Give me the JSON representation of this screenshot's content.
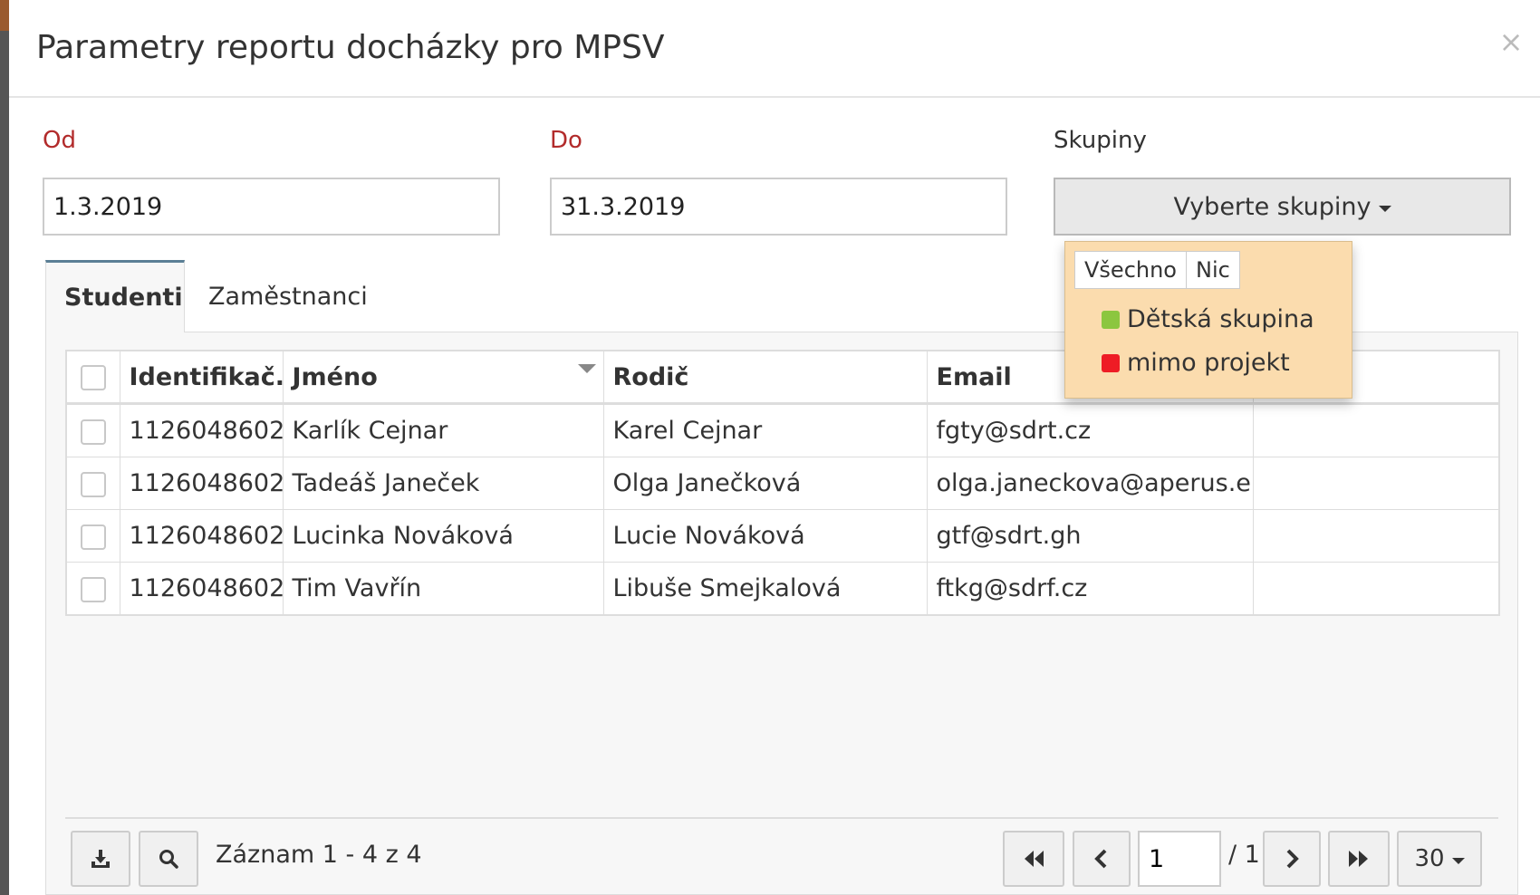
{
  "modal": {
    "title": "Parametry reportu docházky pro MPSV",
    "close_symbol": "×"
  },
  "form": {
    "from": {
      "label": "Od",
      "value": "1.3.2019"
    },
    "to": {
      "label": "Do",
      "value": "31.3.2019"
    },
    "groups": {
      "label": "Skupiny",
      "button_label": "Vyberte skupiny"
    }
  },
  "groups_dropdown": {
    "select_all": "Všechno",
    "select_none": "Nic",
    "items": [
      {
        "label": "Dětská skupina",
        "color": "#8cc63f"
      },
      {
        "label": "mimo projekt",
        "color": "#ee1c25"
      }
    ]
  },
  "tabs": [
    {
      "label": "Studenti",
      "active": true
    },
    {
      "label": "Zaměstnanci",
      "active": false
    }
  ],
  "table": {
    "columns": [
      "Identifikač...",
      "Jméno",
      "Rodič",
      "Email",
      ""
    ],
    "rows": [
      {
        "id": "1126048602",
        "name": "Karlík Cejnar",
        "parent": "Karel Cejnar",
        "email": "fgty@sdrt.cz"
      },
      {
        "id": "1126048602",
        "name": "Tadeáš Janeček",
        "parent": "Olga Janečková",
        "email": "olga.janeckova@aperus.eu"
      },
      {
        "id": "1126048602",
        "name": "Lucinka Nováková",
        "parent": "Lucie Nováková",
        "email": "gtf@sdrt.gh"
      },
      {
        "id": "1126048602",
        "name": "Tim Vavřín",
        "parent": "Libuše Smejkalová",
        "email": "ftkg@sdrf.cz"
      }
    ]
  },
  "pager": {
    "records_text": "Záznam 1 - 4 z 4",
    "current_page": "1",
    "total_pages": "/ 1",
    "page_size": "30"
  },
  "icons": [
    "download-icon",
    "search-icon",
    "first-page-icon",
    "prev-page-icon",
    "next-page-icon",
    "last-page-icon",
    "close-icon",
    "sort-desc-icon"
  ]
}
